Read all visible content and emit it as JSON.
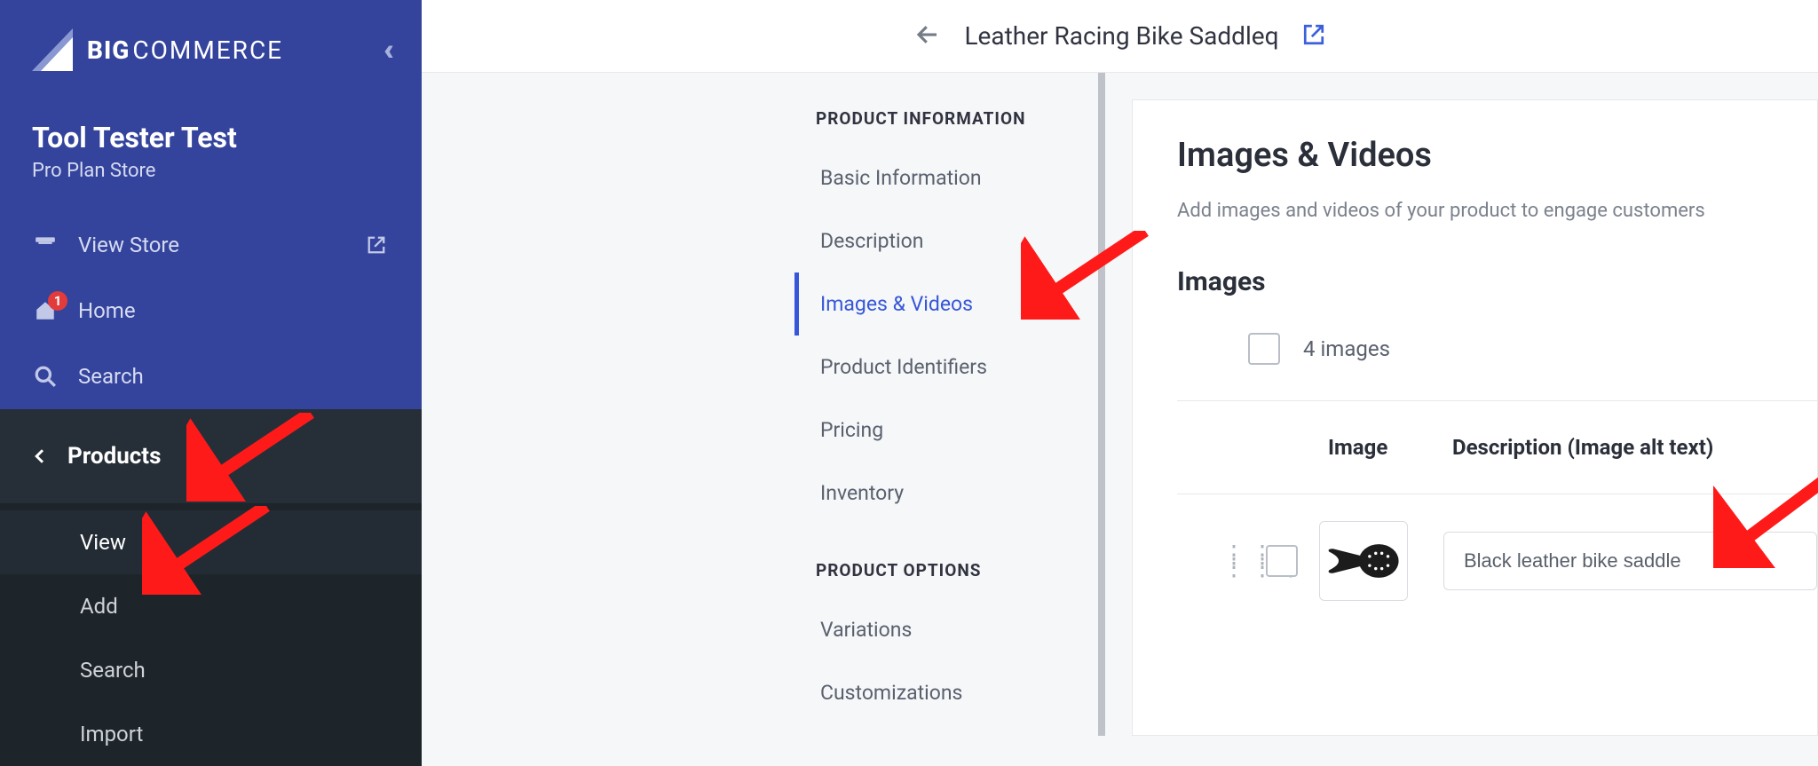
{
  "logo": {
    "big": "BIG",
    "commerce": "COMMERCE"
  },
  "store": {
    "name": "Tool Tester Test",
    "plan": "Pro Plan Store"
  },
  "nav": {
    "view_store": "View Store",
    "home": "Home",
    "home_badge": "1",
    "search": "Search"
  },
  "products": {
    "label": "Products",
    "sub": {
      "view": "View",
      "add": "Add",
      "search": "Search",
      "import": "Import"
    }
  },
  "topbar": {
    "title": "Leather Racing Bike Saddleq"
  },
  "section_nav": {
    "group1_title": "PRODUCT INFORMATION",
    "basic": "Basic Information",
    "description": "Description",
    "images_videos": "Images & Videos",
    "identifiers": "Product Identifiers",
    "pricing": "Pricing",
    "inventory": "Inventory",
    "group2_title": "PRODUCT OPTIONS",
    "variations": "Variations",
    "customizations": "Customizations"
  },
  "panel": {
    "title": "Images & Videos",
    "help": "Add images and videos of your product to engage customers",
    "images_heading": "Images",
    "count_text": "4 images",
    "th_image": "Image",
    "th_desc": "Description (Image alt text)",
    "row1_alt": "Black leather bike saddle"
  }
}
